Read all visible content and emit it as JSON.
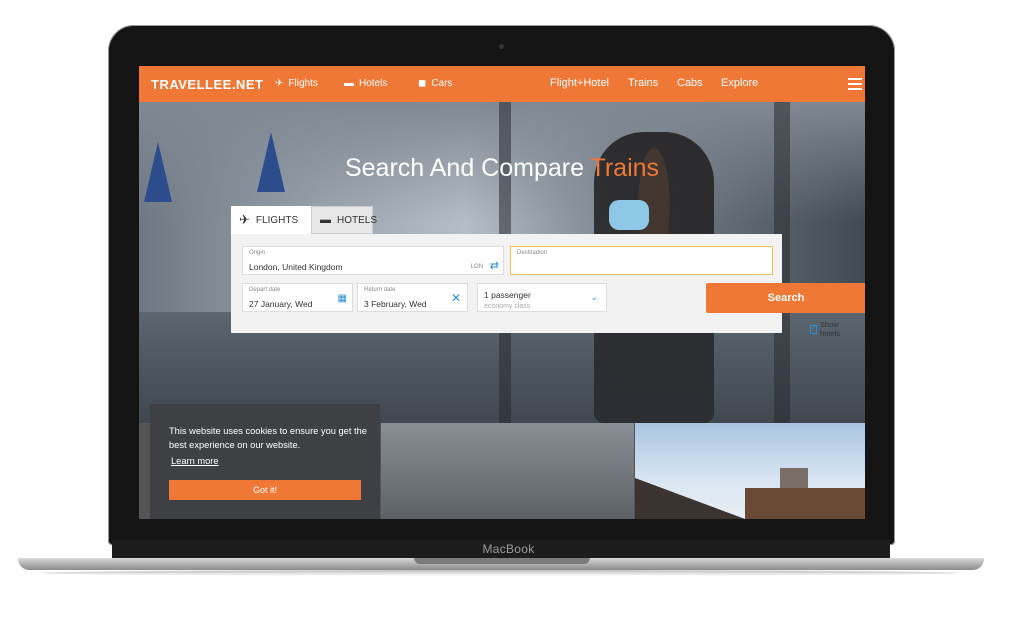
{
  "device": {
    "label": "MacBook"
  },
  "nav": {
    "logo": "TRAVELLEE.NET",
    "left_items": [
      {
        "icon": "plane-icon",
        "label": "Flights"
      },
      {
        "icon": "bed-icon",
        "label": "Hotels"
      },
      {
        "icon": "car-icon",
        "label": "Cars"
      }
    ],
    "right_items": [
      "Flight+Hotel",
      "Trains",
      "Cabs",
      "Explore"
    ],
    "menu_icon": "hamburger-menu-icon"
  },
  "hero": {
    "title_prefix": "Search And Compare",
    "title_highlight": "Trains"
  },
  "search": {
    "tabs": [
      {
        "icon": "plane-icon",
        "label": "FLIGHTS",
        "active": true
      },
      {
        "icon": "bed-icon",
        "label": "HOTELS",
        "active": false
      }
    ],
    "origin": {
      "label": "Origin",
      "value": "London, United Kingdom",
      "code": "LON"
    },
    "destination": {
      "label": "Destination",
      "value": ""
    },
    "depart": {
      "label": "Depart date",
      "value": "27 January, Wed"
    },
    "return": {
      "label": "Return date",
      "value": "3 February, Wed"
    },
    "passengers": {
      "value": "1 passenger",
      "class": "economy class"
    },
    "search_label": "Search",
    "show_hotels": "Show hotels",
    "show_hotels_checked": true
  },
  "cookie": {
    "text": "This website uses cookies to ensure you get the best experience on our website.",
    "learn_more": "Learn more",
    "button": "Got it!"
  },
  "colors": {
    "accent": "#ef7836",
    "link": "#2b8dd6",
    "cookie_bg": "#3f4044"
  }
}
